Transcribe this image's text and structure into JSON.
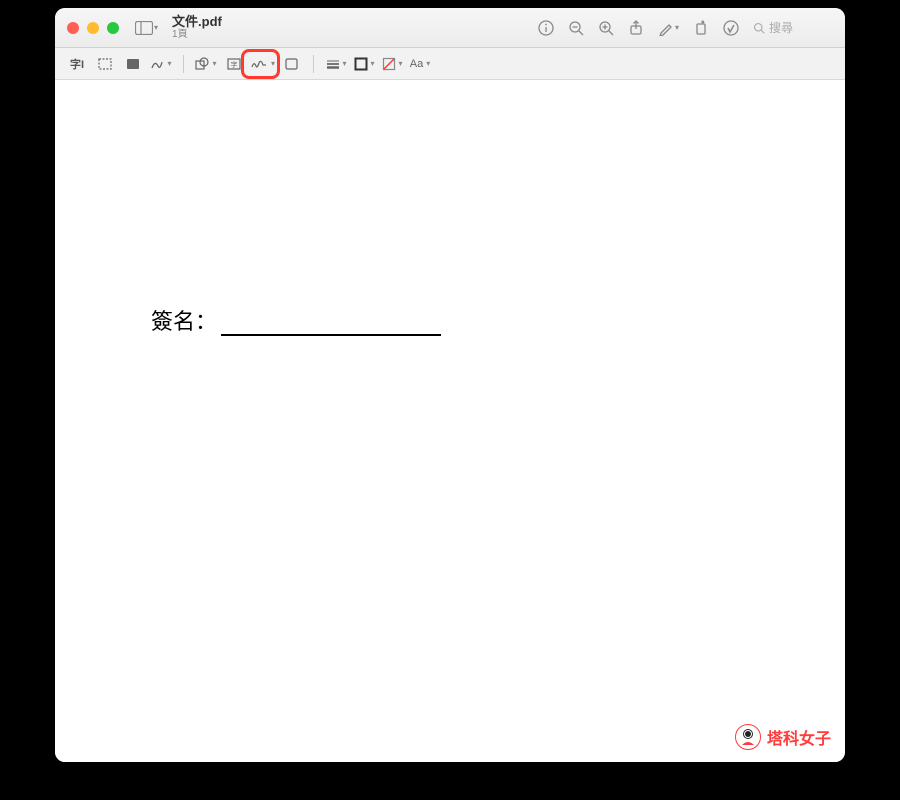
{
  "header": {
    "title": "文件.pdf",
    "subtitle": "1頁",
    "search_placeholder": "搜尋"
  },
  "toolbar": {
    "text_style_label": "Aa"
  },
  "document": {
    "signature_label": "簽名："
  },
  "watermark": {
    "text": "塔科女子"
  }
}
